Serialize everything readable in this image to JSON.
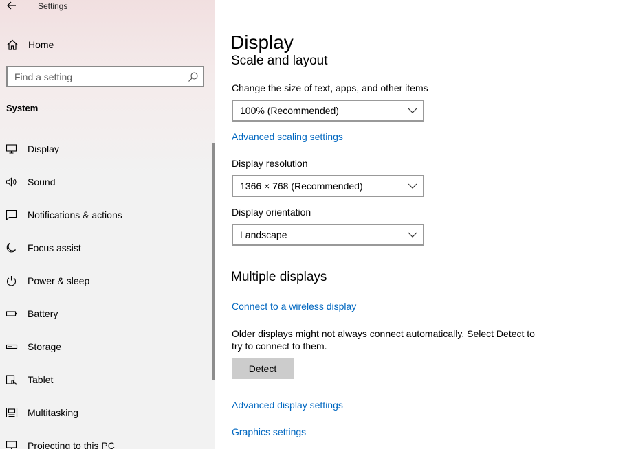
{
  "window": {
    "title": "Settings"
  },
  "sidebar": {
    "home_label": "Home",
    "search_placeholder": "Find a setting",
    "section_label": "System",
    "items": [
      {
        "label": "Display",
        "icon": "monitor-icon"
      },
      {
        "label": "Sound",
        "icon": "speaker-icon"
      },
      {
        "label": "Notifications & actions",
        "icon": "message-icon"
      },
      {
        "label": "Focus assist",
        "icon": "moon-icon"
      },
      {
        "label": "Power & sleep",
        "icon": "power-icon"
      },
      {
        "label": "Battery",
        "icon": "battery-icon"
      },
      {
        "label": "Storage",
        "icon": "storage-icon"
      },
      {
        "label": "Tablet",
        "icon": "tablet-icon"
      },
      {
        "label": "Multitasking",
        "icon": "multitasking-icon"
      },
      {
        "label": "Projecting to this PC",
        "icon": "projector-icon"
      }
    ]
  },
  "main": {
    "page_title": "Display",
    "scale_section_title": "Scale and layout",
    "scale_label": "Change the size of text, apps, and other items",
    "scale_value": "100% (Recommended)",
    "advanced_scaling_link": "Advanced scaling settings",
    "resolution_label": "Display resolution",
    "resolution_value": "1366 × 768 (Recommended)",
    "orientation_label": "Display orientation",
    "orientation_value": "Landscape",
    "multiple_displays_title": "Multiple displays",
    "wireless_link": "Connect to a wireless display",
    "detect_description": "Older displays might not always connect automatically. Select Detect to try to connect to them.",
    "detect_button": "Detect",
    "advanced_display_link": "Advanced display settings",
    "graphics_link": "Graphics settings"
  },
  "colors": {
    "accent_link": "#0067c0",
    "detect_button_bg": "#cccccc"
  }
}
